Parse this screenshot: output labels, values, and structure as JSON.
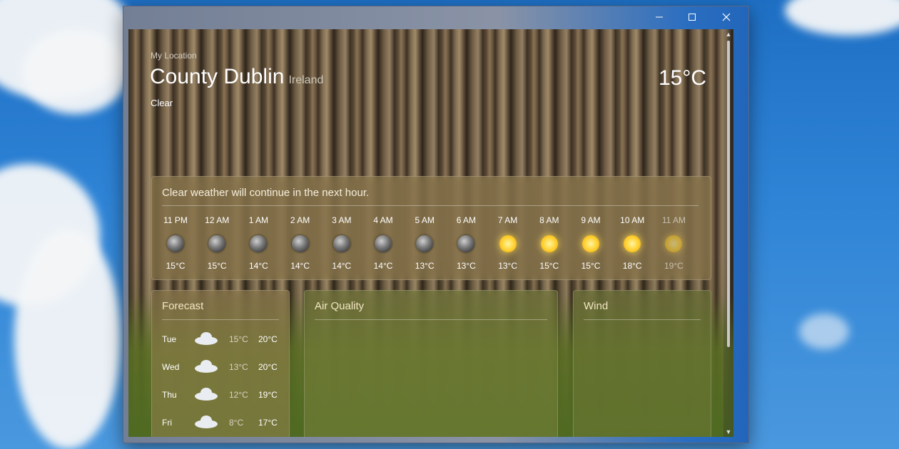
{
  "window": {
    "minimize_icon": "minimize-icon",
    "maximize_icon": "maximize-icon",
    "close_icon": "close-icon"
  },
  "header": {
    "location_label": "My Location",
    "city": "County Dublin",
    "country": "Ireland",
    "condition": "Clear",
    "temperature": "15°C"
  },
  "hourly": {
    "summary": "Clear weather will continue in the next hour.",
    "items": [
      {
        "time": "11 PM",
        "icon": "moon-icon",
        "temp": "15°C"
      },
      {
        "time": "12 AM",
        "icon": "moon-icon",
        "temp": "15°C"
      },
      {
        "time": "1 AM",
        "icon": "moon-icon",
        "temp": "14°C"
      },
      {
        "time": "2 AM",
        "icon": "moon-icon",
        "temp": "14°C"
      },
      {
        "time": "3 AM",
        "icon": "moon-icon",
        "temp": "14°C"
      },
      {
        "time": "4 AM",
        "icon": "moon-icon",
        "temp": "14°C"
      },
      {
        "time": "5 AM",
        "icon": "moon-icon",
        "temp": "13°C"
      },
      {
        "time": "6 AM",
        "icon": "moon-icon",
        "temp": "13°C"
      },
      {
        "time": "7 AM",
        "icon": "sun-icon",
        "temp": "13°C"
      },
      {
        "time": "8 AM",
        "icon": "sun-icon",
        "temp": "15°C"
      },
      {
        "time": "9 AM",
        "icon": "sun-icon",
        "temp": "15°C"
      },
      {
        "time": "10 AM",
        "icon": "sun-icon",
        "temp": "18°C"
      },
      {
        "time": "11 AM",
        "icon": "sun-icon",
        "temp": "19°C"
      }
    ]
  },
  "forecast": {
    "title": "Forecast",
    "days": [
      {
        "day": "Tue",
        "icon": "cloud-icon",
        "low": "15°C",
        "high": "20°C"
      },
      {
        "day": "Wed",
        "icon": "cloud-icon",
        "low": "13°C",
        "high": "20°C"
      },
      {
        "day": "Thu",
        "icon": "cloud-icon",
        "low": "12°C",
        "high": "19°C"
      },
      {
        "day": "Fri",
        "icon": "cloud-icon",
        "low": "8°C",
        "high": "17°C"
      }
    ]
  },
  "air_quality": {
    "title": "Air Quality"
  },
  "wind": {
    "title": "Wind"
  }
}
